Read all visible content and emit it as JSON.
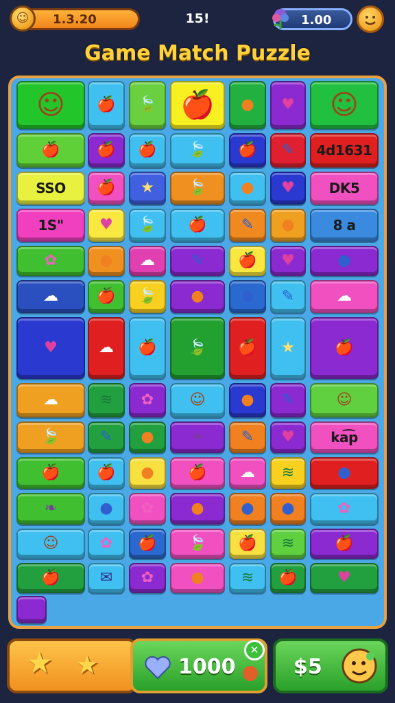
{
  "topbar": {
    "coins": "1.3.20",
    "center_value": "15!",
    "gems": "1.00"
  },
  "title": "Game Match Puzzle",
  "board": {
    "tile_texts": {
      "r1c6": "4d1631",
      "r2c0": "SSO",
      "r2c6": "DK5",
      "r3c0": "1S\"",
      "r3c6": "8 a",
      "r9c6": "ka͡p"
    }
  },
  "bottom": {
    "hearts": "1000",
    "price": "$5"
  },
  "colors": {
    "background": "#1d2440",
    "board": "#4aa8e6",
    "board_border": "#e8a040",
    "title": "#ffd23c"
  }
}
